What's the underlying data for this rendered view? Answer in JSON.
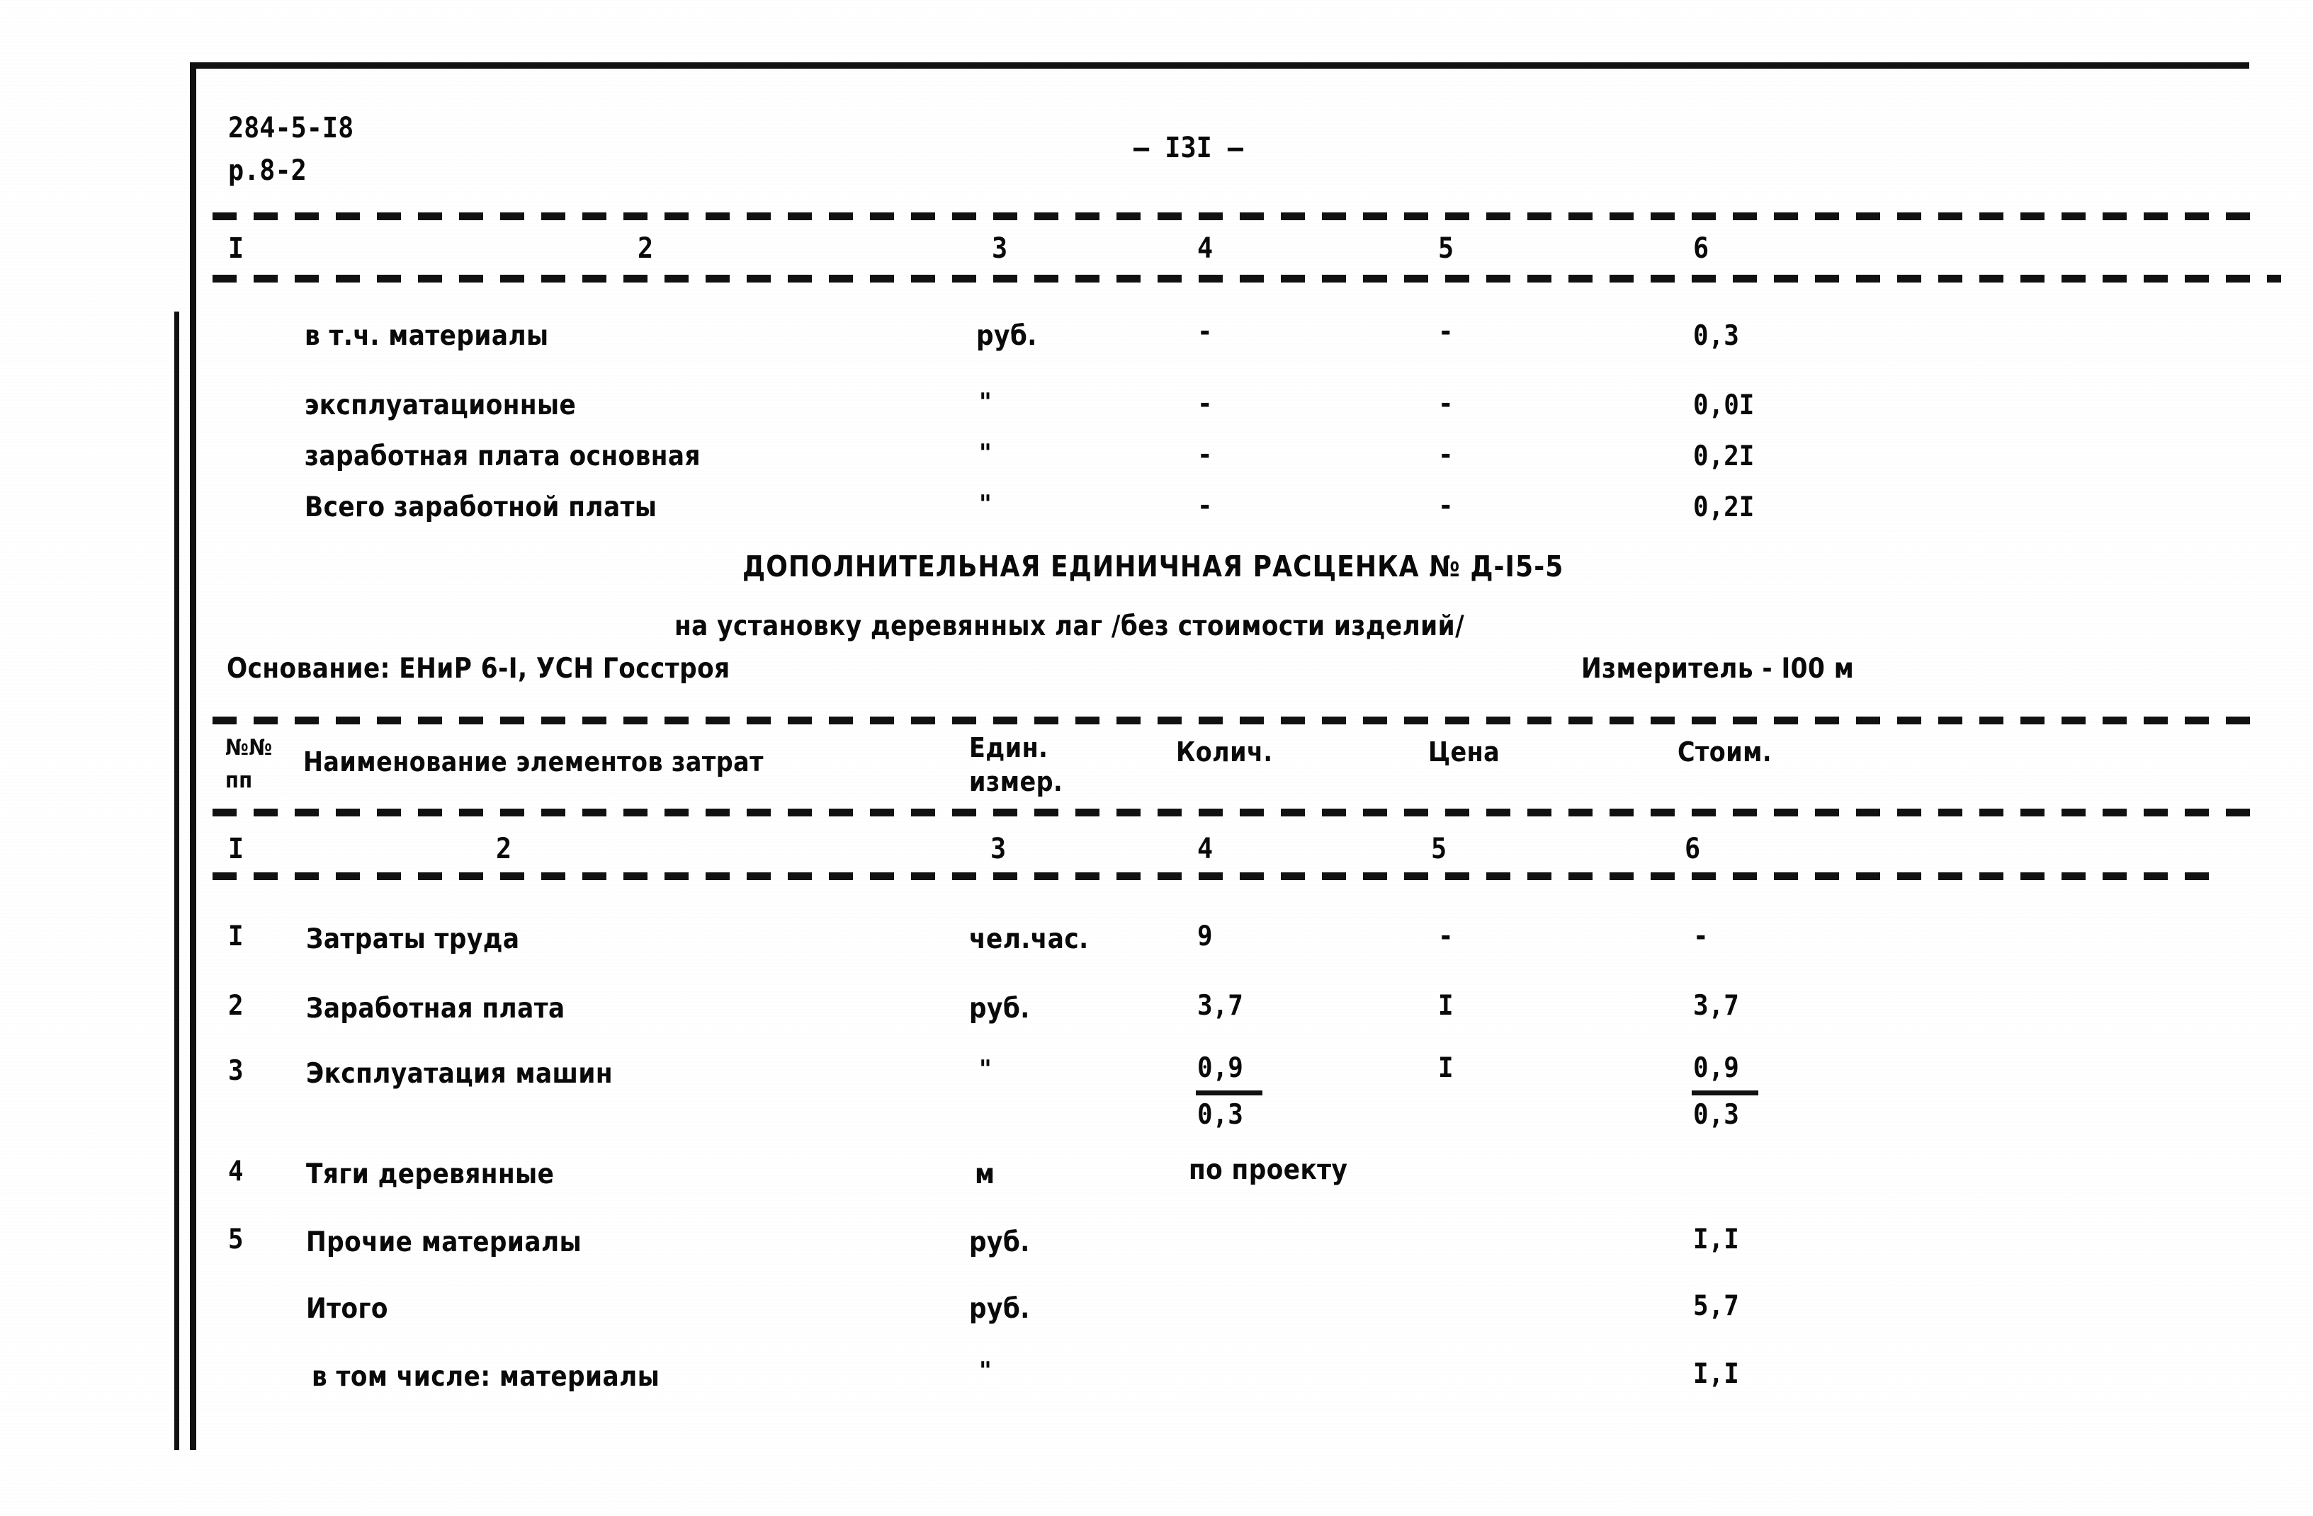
{
  "document": {
    "code_line1": "284-5-I8",
    "code_line2": "р.8-2",
    "page_number": "— I3I —"
  },
  "table_top": {
    "column_numbers": [
      "I",
      "2",
      "3",
      "4",
      "5",
      "6"
    ],
    "rows": [
      {
        "name": "в т.ч. материалы",
        "unit": "руб.",
        "qty": "-",
        "price": "-",
        "cost": "0,3"
      },
      {
        "name": "эксплуатационные",
        "unit": "\"",
        "qty": "-",
        "price": "-",
        "cost": "0,0I"
      },
      {
        "name": "заработная плата основная",
        "unit": "\"",
        "qty": "-",
        "price": "-",
        "cost": "0,2I"
      },
      {
        "name": "Всего заработной платы",
        "unit": "\"",
        "qty": "-",
        "price": "-",
        "cost": "0,2I"
      }
    ]
  },
  "estimate": {
    "title": "ДОПОЛНИТЕЛЬНАЯ ЕДИНИЧНАЯ РАСЦЕНКА № Д-I5-5",
    "subtitle": "на установку деревянных лаг /без стоимости изделий/",
    "basis": "Основание: ЕНиР 6-I, УСН Госстроя",
    "meter": "Измеритель - I00 м"
  },
  "table_main": {
    "headers": {
      "no_line1": "№№",
      "no_line2": "пп",
      "name": "Наименование элементов затрат",
      "unit_line1": "Един.",
      "unit_line2": "измер.",
      "qty": "Колич.",
      "price": "Цена",
      "cost": "Стоим."
    },
    "column_numbers": [
      "I",
      "2",
      "3",
      "4",
      "5",
      "6"
    ],
    "rows": [
      {
        "no": "I",
        "name": "Затраты труда",
        "unit": "чел.час.",
        "qty": "9",
        "price": "-",
        "cost": "-"
      },
      {
        "no": "2",
        "name": "Заработная плата",
        "unit": "руб.",
        "qty": "3,7",
        "price": "I",
        "cost": "3,7"
      },
      {
        "no": "3",
        "name": "Эксплуатация машин",
        "unit": "\"",
        "qty": "0,9",
        "qty_denominator": "0,3",
        "price": "I",
        "cost": "0,9",
        "cost_denominator": "0,3"
      },
      {
        "no": "4",
        "name": "Тяги деревянные",
        "unit": "м",
        "qty": "по проекту",
        "price": "",
        "cost": ""
      },
      {
        "no": "5",
        "name": "Прочие материалы",
        "unit": "руб.",
        "qty": "",
        "price": "",
        "cost": "I,I"
      },
      {
        "no": "",
        "name": "Итого",
        "unit": "руб.",
        "qty": "",
        "price": "",
        "cost": "5,7"
      },
      {
        "no": "",
        "name": "в том числе: материалы",
        "unit": "\"",
        "qty": "",
        "price": "",
        "cost": "I,I"
      }
    ]
  }
}
